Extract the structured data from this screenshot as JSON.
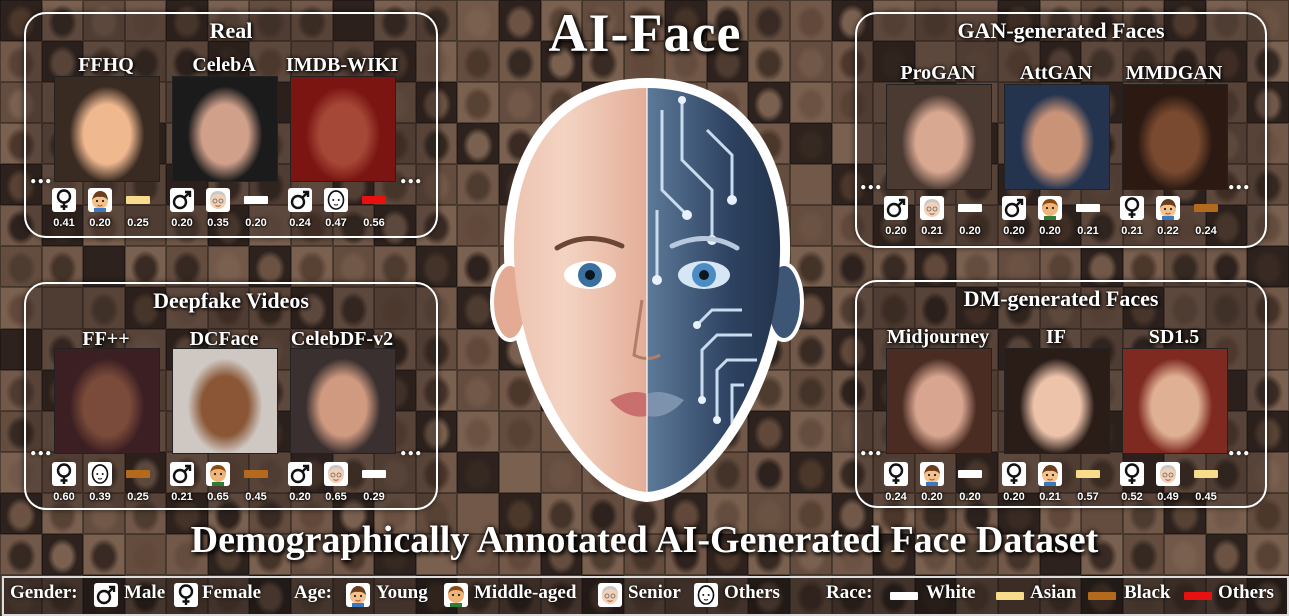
{
  "title": "AI-Face",
  "subtitle": "Demographically Annotated AI-Generated Face Dataset",
  "colors": {
    "white": "#ffffff",
    "asian": "#f7dc8c",
    "black": "#b36a1d",
    "others": "#e8110f"
  },
  "panels": [
    {
      "title": "Real",
      "datasets": [
        {
          "name": "FFHQ",
          "gender_icon": "female-icon",
          "age_icon": "young-icon",
          "race": "asian",
          "values": [
            "0.41",
            "0.20",
            "0.25"
          ],
          "tone": [
            "#f0b88f",
            "#3a2b22"
          ]
        },
        {
          "name": "CelebA",
          "gender_icon": "male-icon",
          "age_icon": "senior-icon",
          "race": "white",
          "values": [
            "0.20",
            "0.35",
            "0.20"
          ],
          "tone": [
            "#d0a08a",
            "#1b1b1b"
          ]
        },
        {
          "name": "IMDB-WIKI",
          "gender_icon": "male-icon",
          "age_icon": "others-age-icon",
          "race": "others",
          "values": [
            "0.24",
            "0.47",
            "0.56"
          ],
          "tone": [
            "#a64838",
            "#7a1512"
          ]
        }
      ]
    },
    {
      "title": "GAN-generated Faces",
      "datasets": [
        {
          "name": "ProGAN",
          "gender_icon": "male-icon",
          "age_icon": "senior-icon",
          "race": "white",
          "values": [
            "0.20",
            "0.21",
            "0.20"
          ],
          "tone": [
            "#d9a891",
            "#4b3a32"
          ]
        },
        {
          "name": "AttGAN",
          "gender_icon": "male-icon",
          "age_icon": "middle-aged-icon",
          "race": "white",
          "values": [
            "0.20",
            "0.20",
            "0.21"
          ],
          "tone": [
            "#c99378",
            "#24344f"
          ]
        },
        {
          "name": "MMDGAN",
          "gender_icon": "female-icon",
          "age_icon": "young-icon",
          "race": "black",
          "values": [
            "0.21",
            "0.22",
            "0.24"
          ],
          "tone": [
            "#7a4a30",
            "#2c1a12"
          ]
        }
      ]
    },
    {
      "title": "Deepfake Videos",
      "datasets": [
        {
          "name": "FF++",
          "gender_icon": "female-icon",
          "age_icon": "others-age-icon",
          "race": "black",
          "values": [
            "0.60",
            "0.39",
            "0.25"
          ],
          "tone": [
            "#7a4a3a",
            "#3c1f22"
          ]
        },
        {
          "name": "DCFace",
          "gender_icon": "male-icon",
          "age_icon": "middle-aged-icon",
          "race": "black",
          "values": [
            "0.21",
            "0.65",
            "0.45"
          ],
          "tone": [
            "#8a5636",
            "#cfc8c2"
          ]
        },
        {
          "name": "CelebDF-v2",
          "gender_icon": "male-icon",
          "age_icon": "senior-icon",
          "race": "white",
          "values": [
            "0.20",
            "0.65",
            "0.29"
          ],
          "tone": [
            "#d09a80",
            "#3a3030"
          ]
        }
      ]
    },
    {
      "title": "DM-generated Faces",
      "datasets": [
        {
          "name": "Midjourney",
          "gender_icon": "female-icon",
          "age_icon": "young-icon",
          "race": "white",
          "values": [
            "0.24",
            "0.20",
            "0.20"
          ],
          "tone": [
            "#d8a590",
            "#4a2c22"
          ]
        },
        {
          "name": "IF",
          "gender_icon": "female-icon",
          "age_icon": "young-icon",
          "race": "asian",
          "values": [
            "0.20",
            "0.21",
            "0.57"
          ],
          "tone": [
            "#edc3aa",
            "#2a1d18"
          ]
        },
        {
          "name": "SD1.5",
          "gender_icon": "female-icon",
          "age_icon": "senior-icon",
          "race": "asian",
          "values": [
            "0.52",
            "0.49",
            "0.45"
          ],
          "tone": [
            "#e0b094",
            "#7e2a20"
          ]
        }
      ]
    }
  ],
  "legend": {
    "gender_label": "Gender:",
    "male": "Male",
    "female": "Female",
    "age_label": "Age:",
    "young": "Young",
    "middle_aged": "Middle-aged",
    "senior": "Senior",
    "age_others": "Others",
    "race_label": "Race:",
    "white": "White",
    "asian": "Asian",
    "black": "Black",
    "race_others": "Others"
  }
}
